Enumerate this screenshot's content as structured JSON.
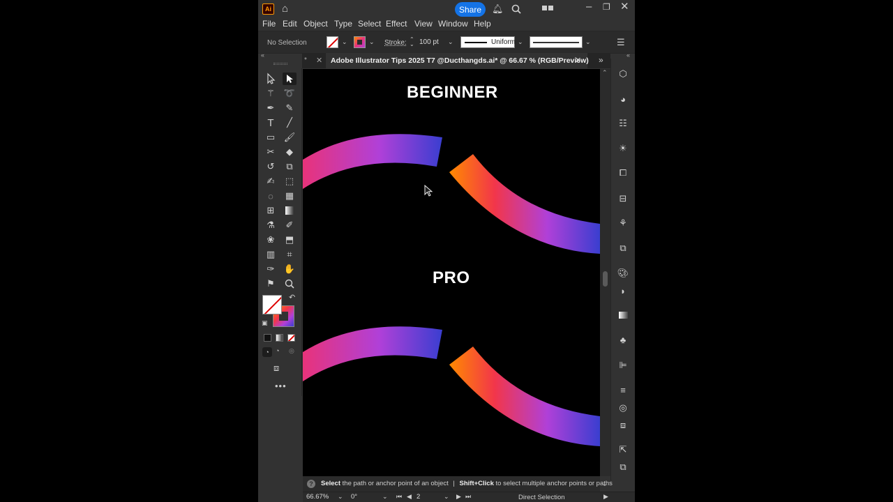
{
  "app": {
    "logo": "Ai",
    "share_label": "Share"
  },
  "menu": [
    "File",
    "Edit",
    "Object",
    "Type",
    "Select",
    "Effect",
    "View",
    "Window",
    "Help"
  ],
  "control": {
    "selection": "No Selection",
    "stroke_label": "Stroke:",
    "stroke_value": "100 pt",
    "profile_label": "Uniform"
  },
  "document": {
    "tab_prefix": "*",
    "title": "Adobe Illustrator Tips 2025 T7 @Ducthangds.ai* @ 66.67 % (RGB/Preview)"
  },
  "artboard": {
    "heading1": "BEGINNER",
    "heading2": "PRO"
  },
  "hint": {
    "bold1": "Select",
    "text1": "the path or anchor point of an object",
    "sep": "|",
    "bold2": "Shift+Click",
    "text2": "to select multiple anchor points or paths"
  },
  "status": {
    "zoom": "66.67%",
    "rotation": "0°",
    "artboard_number": "2",
    "current_tool": "Direct Selection"
  },
  "colors": {
    "accent": "#1473e6",
    "gradient_magenta": "#e8337a",
    "gradient_purple": "#b040d8",
    "gradient_blue": "#3a3ed0",
    "gradient_orange": "#ff8a00",
    "gradient_red": "#f2364a"
  }
}
